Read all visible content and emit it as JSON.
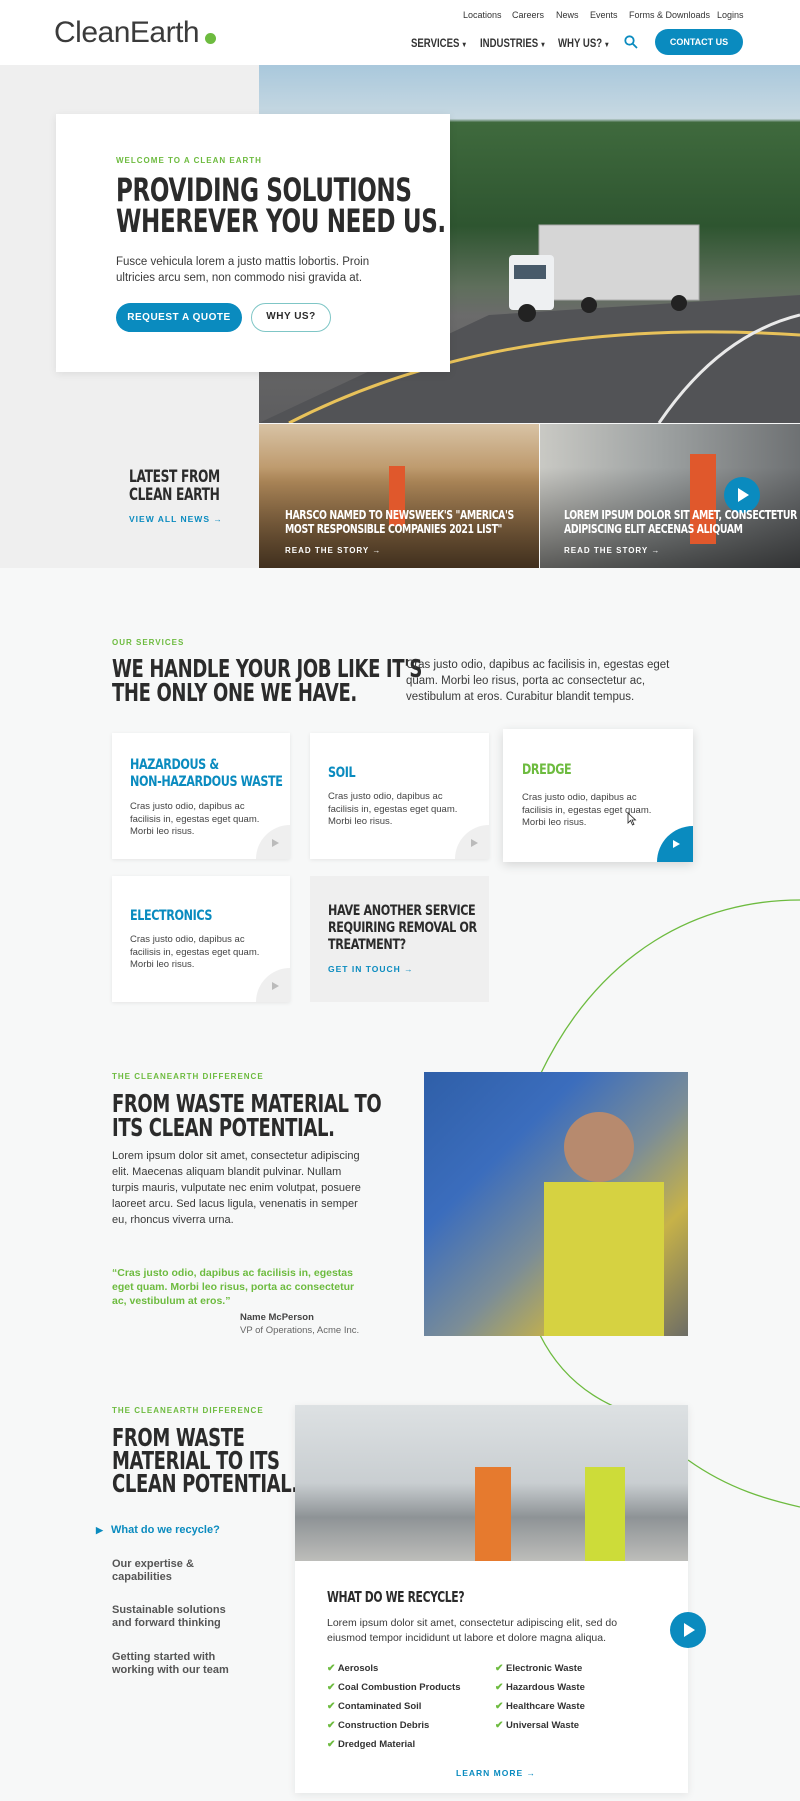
{
  "header": {
    "logo": "CleanEarth",
    "utility_links": [
      "Locations",
      "Careers",
      "News",
      "Events",
      "Forms & Downloads",
      "Logins"
    ],
    "nav": [
      "SERVICES",
      "INDUSTRIES",
      "WHY US?"
    ],
    "contact_label": "CONTACT US",
    "colors": {
      "accent": "#0a8bbf",
      "green": "#6dbb3f"
    }
  },
  "hero": {
    "eyebrow": "WELCOME TO A CLEAN EARTH",
    "title_line1": "PROVIDING SOLUTIONS",
    "title_line2": "WHEREVER YOU NEED US.",
    "text": "Fusce vehicula lorem a justo mattis lobortis. Proin ultricies arcu sem, non commodo nisi gravida at.",
    "primary_label": "REQUEST A QUOTE",
    "secondary_label": "WHY US?"
  },
  "news": {
    "heading_line1": "LATEST FROM",
    "heading_line2": "CLEAN EARTH",
    "view_all": "VIEW ALL NEWS",
    "items": [
      {
        "title_line1": "HARSCO NAMED TO NEWSWEEK'S \"AMERICA'S",
        "title_line2": "MOST RESPONSIBLE COMPANIES 2021 LIST\"",
        "link": "READ THE STORY"
      },
      {
        "title_line1": "LOREM IPSUM DOLOR SIT AMET, CONSECTETUR",
        "title_line2": "ADIPISCING ELIT AECENAS ALIQUAM",
        "link": "READ THE STORY"
      }
    ]
  },
  "services": {
    "eyebrow": "OUR SERVICES",
    "title_line1": "WE HANDLE YOUR JOB LIKE IT'S",
    "title_line2": "THE ONLY ONE WE HAVE.",
    "intro": "Cras justo odio, dapibus ac facilisis in, egestas eget quam. Morbi leo risus, porta ac consectetur ac, vestibulum at eros. Curabitur blandit tempus.",
    "cards": [
      {
        "title_line1": "HAZARDOUS &",
        "title_line2": "NON-HAZARDOUS WASTE",
        "desc": "Cras justo odio, dapibus ac facilisis in, egestas eget quam. Morbi leo risus."
      },
      {
        "title_line1": "SOIL",
        "desc": "Cras justo odio, dapibus ac facilisis in, egestas eget quam. Morbi leo risus."
      },
      {
        "title_line1": "DREDGE",
        "desc": "Cras justo odio, dapibus ac facilisis in, egestas eget quam. Morbi leo risus."
      },
      {
        "title_line1": "ELECTRONICS",
        "desc": "Cras justo odio, dapibus ac facilisis in, egestas eget quam. Morbi leo risus."
      }
    ],
    "other_line1": "HAVE ANOTHER SERVICE",
    "other_line2": "REQUIRING REMOVAL OR",
    "other_line3": "TREATMENT?",
    "get_in_touch": "GET IN TOUCH"
  },
  "difference": {
    "eyebrow": "THE CLEANEARTH DIFFERENCE",
    "title_line1": "FROM WASTE MATERIAL TO",
    "title_line2": "ITS CLEAN POTENTIAL.",
    "text": "Lorem ipsum dolor sit amet, consectetur adipiscing elit. Maecenas aliquam blandit pulvinar. Nullam turpis mauris, vulputate nec enim volutpat, posuere laoreet arcu. Sed lacus ligula, venenatis in semper eu, rhoncus viverra urna.",
    "quote": "“Cras justo odio, dapibus ac facilisis in, egestas eget quam. Morbi leo risus, porta ac consectetur ac, vestibulum at eros.”",
    "author": "Name McPerson",
    "role": "VP of Operations, Acme Inc."
  },
  "recycle": {
    "eyebrow": "THE CLEANEARTH DIFFERENCE",
    "title_line1": "FROM WASTE",
    "title_line2": "MATERIAL TO ITS",
    "title_line3": "CLEAN POTENTIAL.",
    "side_items": [
      {
        "line1": "What do we recycle?"
      },
      {
        "line1": "Our expertise &",
        "line2": "capabilities"
      },
      {
        "line1": "Sustainable solutions",
        "line2": "and forward thinking"
      },
      {
        "line1": "Getting started with",
        "line2": "working with our team"
      }
    ],
    "card_title": "WHAT DO WE RECYCLE?",
    "card_text": "Lorem ipsum dolor sit amet, consectetur adipiscing elit, sed do eiusmod tempor incididunt ut labore et dolore magna aliqua.",
    "list_left": [
      "Aerosols",
      "Coal Combustion Products",
      "Contaminated Soil",
      "Construction Debris",
      "Dredged Material"
    ],
    "list_right": [
      "Electronic Waste",
      "Hazardous Waste",
      "Healthcare Waste",
      "Universal Waste"
    ],
    "learn_more": "LEARN MORE"
  }
}
